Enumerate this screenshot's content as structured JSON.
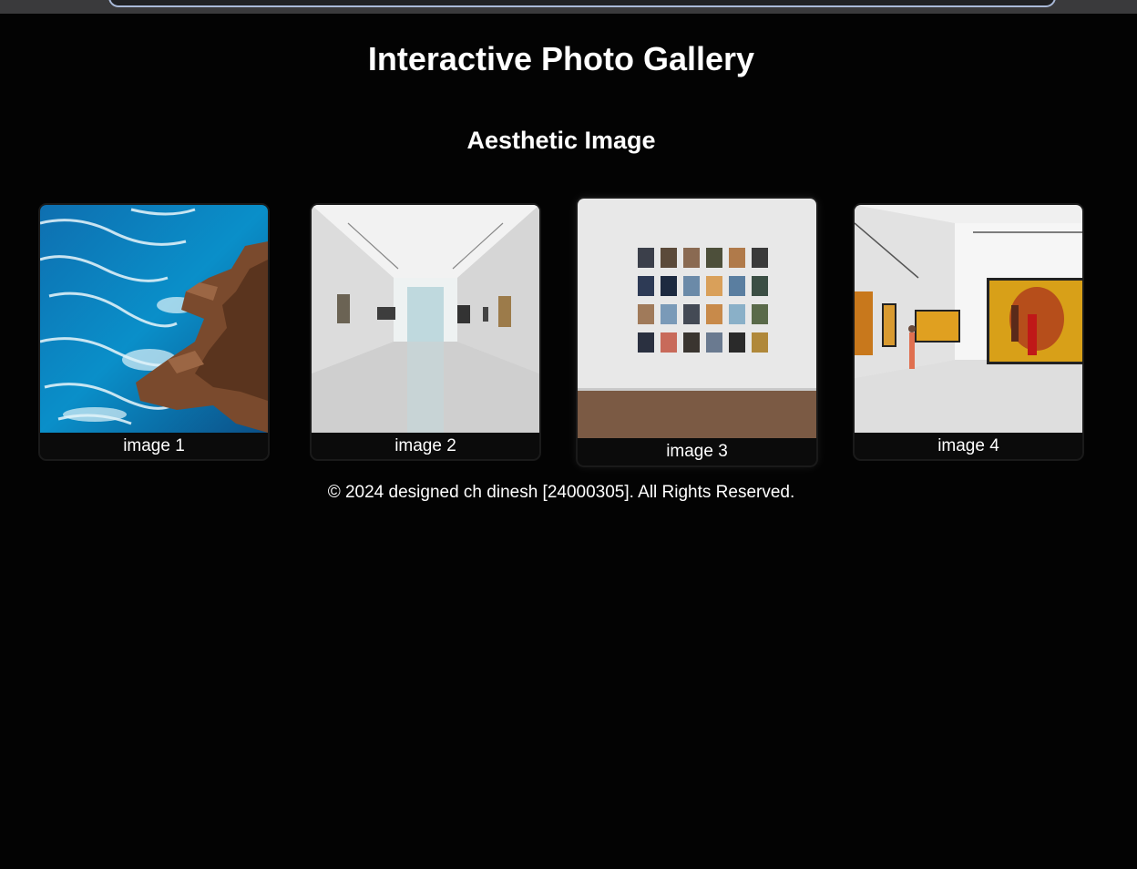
{
  "header": {
    "title": "Interactive Photo Gallery",
    "subtitle": "Aesthetic Image"
  },
  "gallery": {
    "items": [
      {
        "caption": "image 1",
        "image": "ocean-rocks-photo"
      },
      {
        "caption": "image 2",
        "image": "empty-gallery-hall-photo"
      },
      {
        "caption": "image 3",
        "image": "photo-grid-wall-photo"
      },
      {
        "caption": "image 4",
        "image": "colorful-paintings-gallery-photo"
      }
    ]
  },
  "footer": {
    "text": "© 2024 designed ch dinesh [24000305]. All Rights Reserved."
  },
  "colors": {
    "background": "#030303",
    "text": "#ffffff",
    "card_border": "#1a1a1a",
    "browser_bar": "#3a3a3c",
    "address_outline": "#a9b9d8"
  }
}
